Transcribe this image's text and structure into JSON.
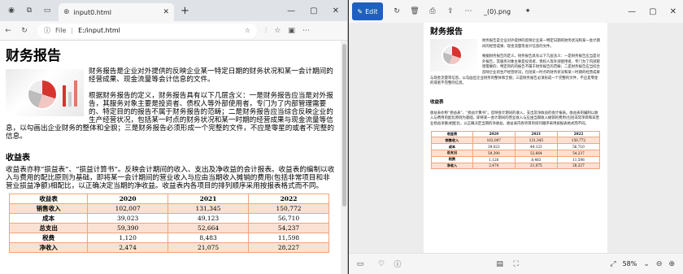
{
  "browser": {
    "tab_title": "input0.html",
    "url_prefix": "File",
    "url_path": "E:/input.html"
  },
  "doc": {
    "title": "财务报告",
    "para1": "财务报告是企业对外提供的反映企业某一特定日期的财务状况和某一会计期间的经营成果、现金流量等会计信息的文件。",
    "para2": "根据财务报告的定义，财务报告具有以下几层含义：一是财务报告应当是对外报告，其服务对象主要是投资者、债权人等外部使用者，专门为了内部管理需要的、特定目的的报告不属于财务报告的范畴；二是财务报告应当综合反映企业的生产经营状况，包括某一时点的财务状况和某一时期的经营成果与现金流量等信息，以勾画出企业财务的整体和全貌；三是财务报告必须形成一个完整的文件，不应是零星的或者不完整的信息。",
    "section_title": "收益表",
    "section_text": "收益表亦称“损益表”、“损益计算书”。反映会计期间的收入、支出及净收益的会计报表。收益表的编制以收入与费用的配比原则为基础，即将某一会计期间的营业收入与应由当期收入摊销的费用(包括非常项目和非营业损益净额)相配比，以正确决定当期的净收益。收益表内各项目的排列顺序采用按报表格式而不同。",
    "table": {
      "headers": [
        "收益表",
        "2020",
        "2021",
        "2022"
      ],
      "rows": [
        [
          "销售收入",
          "102,007",
          "131,345",
          "150,772"
        ],
        [
          "成本",
          "39,023",
          "49,123",
          "56,710"
        ],
        [
          "总支出",
          "59,390",
          "52,664",
          "54,237"
        ],
        [
          "税费",
          "1,120",
          "8,483",
          "11,598"
        ],
        [
          "净收入",
          "2,474",
          "21,075",
          "28,227"
        ]
      ]
    }
  },
  "viewer": {
    "edit_label": "Edit",
    "file_name": "_(0).png",
    "zoom": "58%"
  },
  "colors": {
    "edit_blue": "#1e5fbf",
    "table_border": "#f4a37a",
    "table_stripe": "#fbe1d3"
  }
}
